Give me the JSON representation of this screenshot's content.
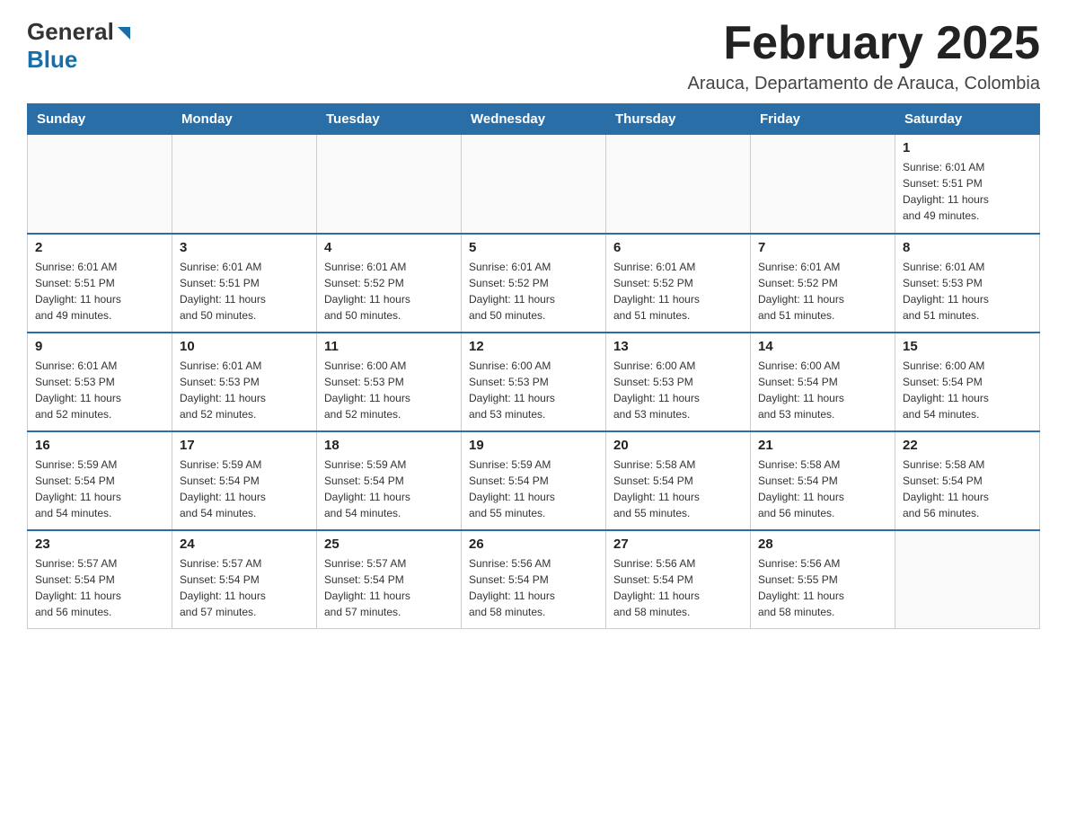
{
  "header": {
    "logo_general": "General",
    "logo_blue": "Blue",
    "month_title": "February 2025",
    "location": "Arauca, Departamento de Arauca, Colombia"
  },
  "weekdays": [
    "Sunday",
    "Monday",
    "Tuesday",
    "Wednesday",
    "Thursday",
    "Friday",
    "Saturday"
  ],
  "weeks": [
    [
      {
        "day": "",
        "info": ""
      },
      {
        "day": "",
        "info": ""
      },
      {
        "day": "",
        "info": ""
      },
      {
        "day": "",
        "info": ""
      },
      {
        "day": "",
        "info": ""
      },
      {
        "day": "",
        "info": ""
      },
      {
        "day": "1",
        "info": "Sunrise: 6:01 AM\nSunset: 5:51 PM\nDaylight: 11 hours\nand 49 minutes."
      }
    ],
    [
      {
        "day": "2",
        "info": "Sunrise: 6:01 AM\nSunset: 5:51 PM\nDaylight: 11 hours\nand 49 minutes."
      },
      {
        "day": "3",
        "info": "Sunrise: 6:01 AM\nSunset: 5:51 PM\nDaylight: 11 hours\nand 50 minutes."
      },
      {
        "day": "4",
        "info": "Sunrise: 6:01 AM\nSunset: 5:52 PM\nDaylight: 11 hours\nand 50 minutes."
      },
      {
        "day": "5",
        "info": "Sunrise: 6:01 AM\nSunset: 5:52 PM\nDaylight: 11 hours\nand 50 minutes."
      },
      {
        "day": "6",
        "info": "Sunrise: 6:01 AM\nSunset: 5:52 PM\nDaylight: 11 hours\nand 51 minutes."
      },
      {
        "day": "7",
        "info": "Sunrise: 6:01 AM\nSunset: 5:52 PM\nDaylight: 11 hours\nand 51 minutes."
      },
      {
        "day": "8",
        "info": "Sunrise: 6:01 AM\nSunset: 5:53 PM\nDaylight: 11 hours\nand 51 minutes."
      }
    ],
    [
      {
        "day": "9",
        "info": "Sunrise: 6:01 AM\nSunset: 5:53 PM\nDaylight: 11 hours\nand 52 minutes."
      },
      {
        "day": "10",
        "info": "Sunrise: 6:01 AM\nSunset: 5:53 PM\nDaylight: 11 hours\nand 52 minutes."
      },
      {
        "day": "11",
        "info": "Sunrise: 6:00 AM\nSunset: 5:53 PM\nDaylight: 11 hours\nand 52 minutes."
      },
      {
        "day": "12",
        "info": "Sunrise: 6:00 AM\nSunset: 5:53 PM\nDaylight: 11 hours\nand 53 minutes."
      },
      {
        "day": "13",
        "info": "Sunrise: 6:00 AM\nSunset: 5:53 PM\nDaylight: 11 hours\nand 53 minutes."
      },
      {
        "day": "14",
        "info": "Sunrise: 6:00 AM\nSunset: 5:54 PM\nDaylight: 11 hours\nand 53 minutes."
      },
      {
        "day": "15",
        "info": "Sunrise: 6:00 AM\nSunset: 5:54 PM\nDaylight: 11 hours\nand 54 minutes."
      }
    ],
    [
      {
        "day": "16",
        "info": "Sunrise: 5:59 AM\nSunset: 5:54 PM\nDaylight: 11 hours\nand 54 minutes."
      },
      {
        "day": "17",
        "info": "Sunrise: 5:59 AM\nSunset: 5:54 PM\nDaylight: 11 hours\nand 54 minutes."
      },
      {
        "day": "18",
        "info": "Sunrise: 5:59 AM\nSunset: 5:54 PM\nDaylight: 11 hours\nand 54 minutes."
      },
      {
        "day": "19",
        "info": "Sunrise: 5:59 AM\nSunset: 5:54 PM\nDaylight: 11 hours\nand 55 minutes."
      },
      {
        "day": "20",
        "info": "Sunrise: 5:58 AM\nSunset: 5:54 PM\nDaylight: 11 hours\nand 55 minutes."
      },
      {
        "day": "21",
        "info": "Sunrise: 5:58 AM\nSunset: 5:54 PM\nDaylight: 11 hours\nand 56 minutes."
      },
      {
        "day": "22",
        "info": "Sunrise: 5:58 AM\nSunset: 5:54 PM\nDaylight: 11 hours\nand 56 minutes."
      }
    ],
    [
      {
        "day": "23",
        "info": "Sunrise: 5:57 AM\nSunset: 5:54 PM\nDaylight: 11 hours\nand 56 minutes."
      },
      {
        "day": "24",
        "info": "Sunrise: 5:57 AM\nSunset: 5:54 PM\nDaylight: 11 hours\nand 57 minutes."
      },
      {
        "day": "25",
        "info": "Sunrise: 5:57 AM\nSunset: 5:54 PM\nDaylight: 11 hours\nand 57 minutes."
      },
      {
        "day": "26",
        "info": "Sunrise: 5:56 AM\nSunset: 5:54 PM\nDaylight: 11 hours\nand 58 minutes."
      },
      {
        "day": "27",
        "info": "Sunrise: 5:56 AM\nSunset: 5:54 PM\nDaylight: 11 hours\nand 58 minutes."
      },
      {
        "day": "28",
        "info": "Sunrise: 5:56 AM\nSunset: 5:55 PM\nDaylight: 11 hours\nand 58 minutes."
      },
      {
        "day": "",
        "info": ""
      }
    ]
  ]
}
